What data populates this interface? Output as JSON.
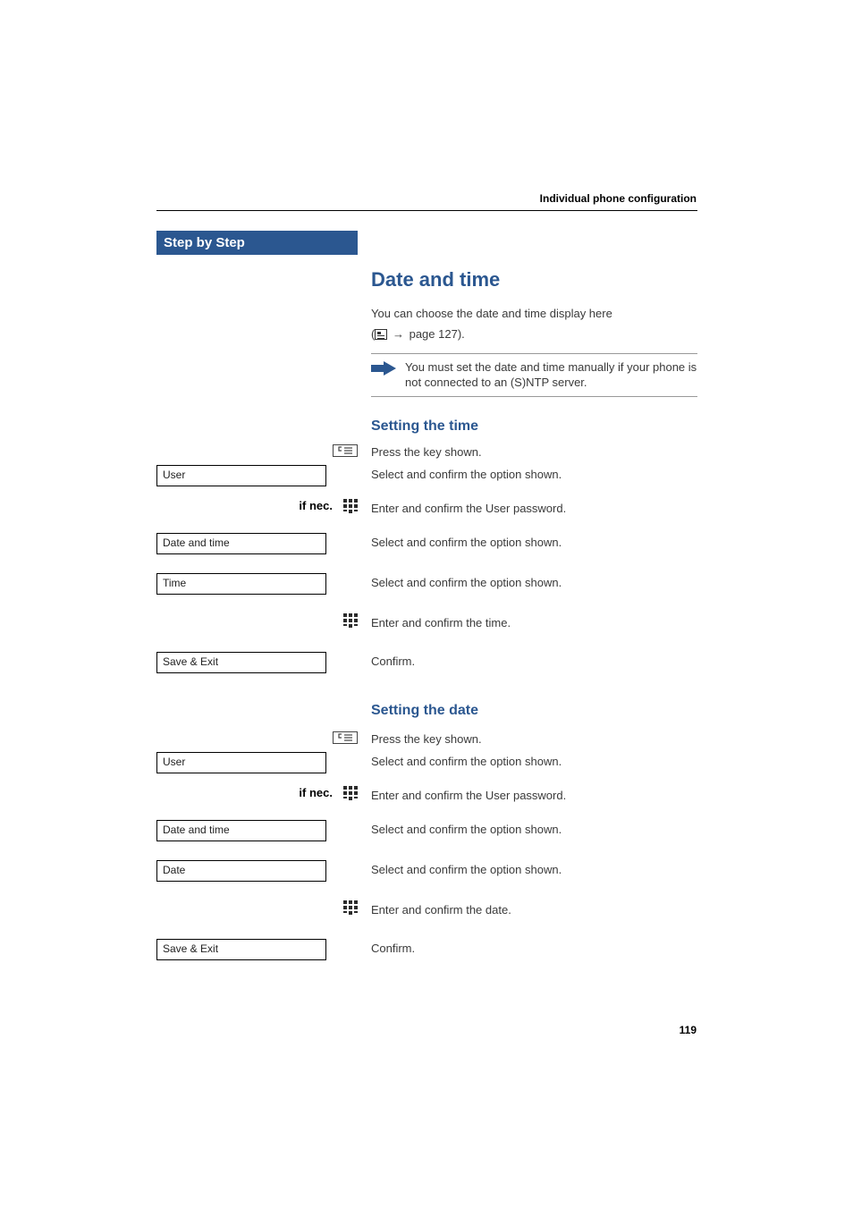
{
  "header": {
    "title": "Individual phone configuration"
  },
  "sidebar": {
    "title": "Step by Step"
  },
  "main": {
    "h1": "Date and time",
    "intro_line1": "You can choose the date and time display here",
    "intro_ref_prefix": "(",
    "intro_ref_arrow": "→",
    "intro_ref_page": "page 127).",
    "note": "You must set the date and time manually if your phone is not connected to an (S)NTP server.",
    "section_time": {
      "title": "Setting the time",
      "steps": [
        {
          "left_type": "menukey",
          "text": "Press the key shown."
        },
        {
          "left_type": "box",
          "left_label": "User",
          "text": "Select and confirm the option shown."
        },
        {
          "left_type": "ifnec",
          "left_label": "if nec.",
          "text": "Enter and confirm the User password."
        },
        {
          "left_type": "box",
          "left_label": "Date and time",
          "text": "Select and confirm the option shown."
        },
        {
          "left_type": "box",
          "left_label": "Time",
          "text": "Select and confirm the option shown."
        },
        {
          "left_type": "keypad",
          "text": "Enter and confirm the time."
        },
        {
          "left_type": "box",
          "left_label": "Save & Exit",
          "text": "Confirm."
        }
      ]
    },
    "section_date": {
      "title": "Setting the date",
      "steps": [
        {
          "left_type": "menukey",
          "text": "Press the key shown."
        },
        {
          "left_type": "box",
          "left_label": "User",
          "text": "Select and confirm the option shown."
        },
        {
          "left_type": "ifnec",
          "left_label": "if nec.",
          "text": "Enter and confirm the User password."
        },
        {
          "left_type": "box",
          "left_label": "Date and time",
          "text": "Select and confirm the option shown."
        },
        {
          "left_type": "box",
          "left_label": "Date",
          "text": "Select and confirm the option shown."
        },
        {
          "left_type": "keypad",
          "text": "Enter and confirm the date."
        },
        {
          "left_type": "box",
          "left_label": "Save & Exit",
          "text": "Confirm."
        }
      ]
    }
  },
  "page_number": "119"
}
